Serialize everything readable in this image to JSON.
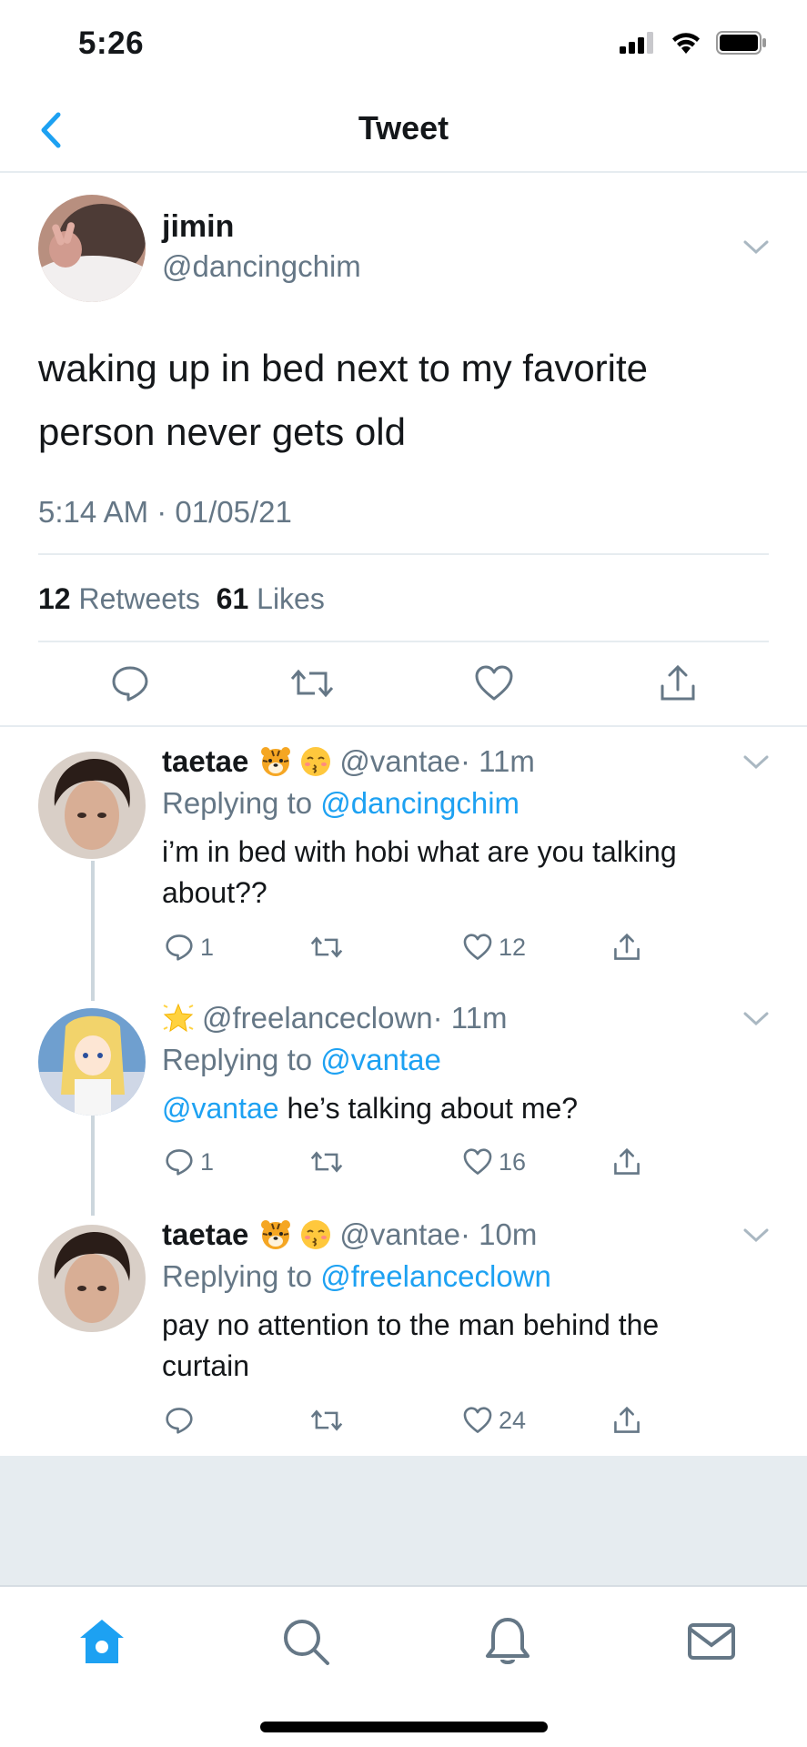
{
  "status_bar": {
    "time": "5:26"
  },
  "nav": {
    "title": "Tweet"
  },
  "main_tweet": {
    "name": "jimin",
    "handle": "@dancingchim",
    "text": "waking up in bed next to my favorite person never gets old",
    "timestamp": "5:14 AM · 01/05/21",
    "retweet_count": "12",
    "retweet_label": "Retweets",
    "like_count": "61",
    "like_label": "Likes"
  },
  "replies": [
    {
      "name": "taetae",
      "emojis": [
        "tiger-face-emoji",
        "kissing-face-emoji"
      ],
      "handle": "@vantae",
      "time": "· 11m",
      "replying_prefix": "Replying to ",
      "replying_to": "@dancingchim",
      "text": "i’m in bed with hobi what are you talking about??",
      "reply_count": "1",
      "retweet_count": "",
      "like_count": "12"
    },
    {
      "name": "",
      "emojis": [
        "glowing-star-emoji"
      ],
      "handle": "@freelanceclown",
      "time": "· 11m",
      "replying_prefix": "Replying to ",
      "replying_to": "@vantae",
      "mention": "@vantae",
      "text": " he’s talking about me?",
      "reply_count": "1",
      "retweet_count": "",
      "like_count": "16"
    },
    {
      "name": "taetae",
      "emojis": [
        "tiger-face-emoji",
        "kissing-face-emoji"
      ],
      "handle": "@vantae",
      "time": "· 10m",
      "replying_prefix": "Replying to ",
      "replying_to": "@freelanceclown",
      "text": "pay no attention to the man behind the curtain",
      "reply_count": "",
      "retweet_count": "",
      "like_count": "24"
    }
  ],
  "colors": {
    "accent": "#1da1f2",
    "secondary_text": "#657786",
    "divider": "#e6ecf0"
  },
  "tab_bar": {
    "icons": [
      "home-icon",
      "search-icon",
      "notifications-bell-icon",
      "messages-mail-icon"
    ],
    "active": "home-icon"
  }
}
